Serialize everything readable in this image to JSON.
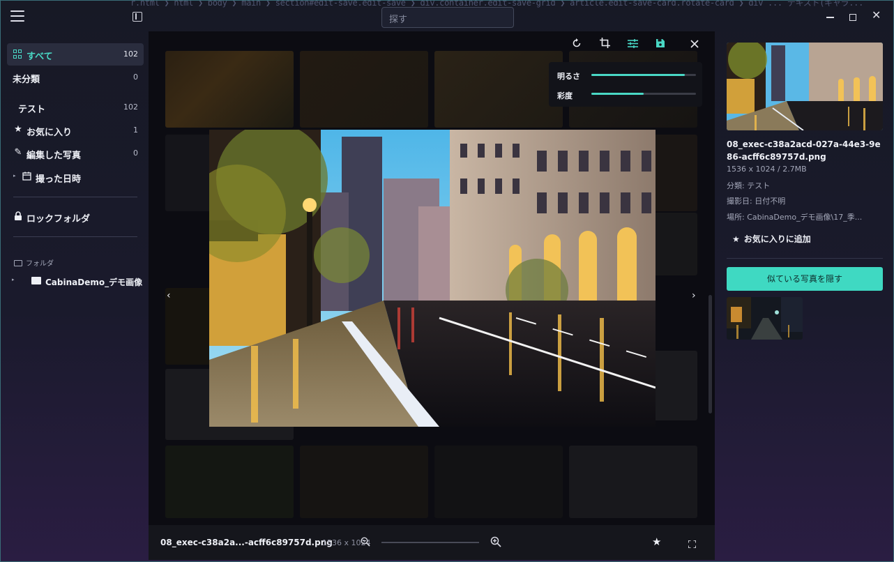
{
  "window": {
    "breadcrumb_ghost": "r.html ❯ html ❯ body ❯ main ❯ section#edit-save.edit-save ❯ div.container.edit-save-grid ❯ article.edit-save-card.rotate-card ❯ div ... テキスト(ギャラ...",
    "search_placeholder": "探す",
    "close_glyph": "✕"
  },
  "sidebar": {
    "items": [
      {
        "label": "すべて",
        "count": "102",
        "icon": "grid-icon",
        "active": true
      },
      {
        "label": "未分類",
        "count": "0",
        "icon": ""
      },
      {
        "label": "テスト",
        "count": "102",
        "icon": ""
      },
      {
        "label": "お気に入り",
        "count": "1",
        "icon": "star-icon"
      },
      {
        "label": "編集した写真",
        "count": "0",
        "icon": "pencil-icon"
      },
      {
        "label": "撮った日時",
        "count": "",
        "icon": "calendar-icon"
      }
    ],
    "lock_folder": "ロックフォルダ",
    "folders_heading": "フォルダ",
    "folder_item": "CabinaDemo_デモ画像"
  },
  "viewer": {
    "tools": [
      "rotate-icon",
      "crop-icon",
      "adjust-icon",
      "save-icon",
      "close-icon"
    ],
    "adjust": {
      "brightness_label": "明るさ",
      "brightness_value": 0.89,
      "saturation_label": "彩度",
      "saturation_value": 0.5
    },
    "filename": "08_exec-c38a2a...-acff6c89757d.png",
    "dimensions": "1536 x 1024",
    "prev_arrow": "‹",
    "next_arrow": "›"
  },
  "info": {
    "file_name": "08_exec-c38a2acd-027a-44e3-9e86-acff6c89757d.png",
    "size": "1536 x 1024 / 2.7MB",
    "category": "分類: テスト",
    "shot_date": "撮影日: 日付不明",
    "location": "場所: CabinaDemo_デモ画像\\17_季...",
    "favorite_label": "お気に入りに追加",
    "similar_button": "似ている写真を隠す"
  },
  "colors": {
    "accent": "#49d8c5",
    "button": "#3fd9c2",
    "sidebar_active": "#2a2d3e"
  }
}
